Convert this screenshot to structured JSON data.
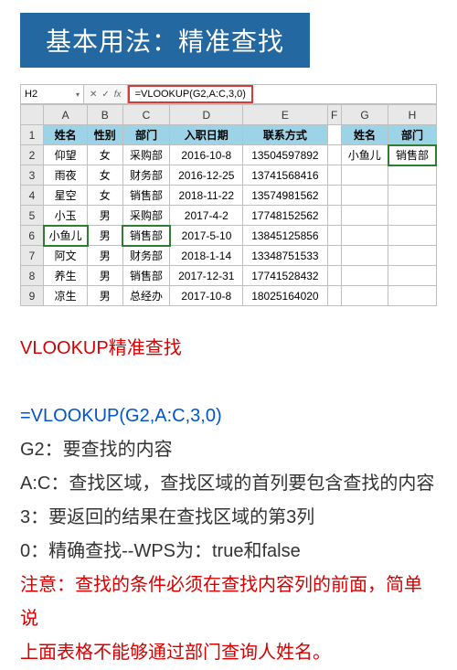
{
  "banner": "基本用法：精准查找",
  "sheet": {
    "name_box": "H2",
    "formula": "=VLOOKUP(G2,A:C,3,0)",
    "col_labels": [
      "A",
      "B",
      "C",
      "D",
      "E",
      "F",
      "G",
      "H"
    ],
    "row_labels": [
      "1",
      "2",
      "3",
      "4",
      "5",
      "6",
      "7",
      "8",
      "9"
    ],
    "headers": [
      "姓名",
      "性别",
      "部门",
      "入职日期",
      "联系方式"
    ],
    "headers2": [
      "姓名",
      "部门"
    ],
    "lookup_name": "小鱼儿",
    "lookup_dept": "销售部",
    "rows": [
      {
        "name": "仰望",
        "sex": "女",
        "dept": "采购部",
        "date": "2016-10-8",
        "tel": "13504597892"
      },
      {
        "name": "雨夜",
        "sex": "女",
        "dept": "财务部",
        "date": "2016-12-25",
        "tel": "13741568416"
      },
      {
        "name": "星空",
        "sex": "女",
        "dept": "销售部",
        "date": "2018-11-22",
        "tel": "13574981562"
      },
      {
        "name": "小玉",
        "sex": "男",
        "dept": "采购部",
        "date": "2017-4-2",
        "tel": "17748152562"
      },
      {
        "name": "小鱼儿",
        "sex": "男",
        "dept": "销售部",
        "date": "2017-5-10",
        "tel": "13845125856"
      },
      {
        "name": "阿文",
        "sex": "男",
        "dept": "财务部",
        "date": "2018-1-14",
        "tel": "13348751533"
      },
      {
        "name": "养生",
        "sex": "男",
        "dept": "销售部",
        "date": "2017-12-31",
        "tel": "17741528432"
      },
      {
        "name": "凉生",
        "sex": "男",
        "dept": "总经办",
        "date": "2017-10-8",
        "tel": "18025164020"
      }
    ]
  },
  "explain": {
    "title": "VLOOKUP精准查找",
    "formula": "=VLOOKUP(G2,A:C,3,0)",
    "l1": "G2：要查找的内容",
    "l2": "A:C：查找区域，查找区域的首列要包含查找的内容",
    "l3": "3：要返回的结果在查找区域的第3列",
    "l4": "0：精确查找--WPS为：true和false",
    "warn1": "注意：查找的条件必须在查找内容列的前面，简单说",
    "warn2": "上面表格不能够通过部门查询人姓名。"
  }
}
